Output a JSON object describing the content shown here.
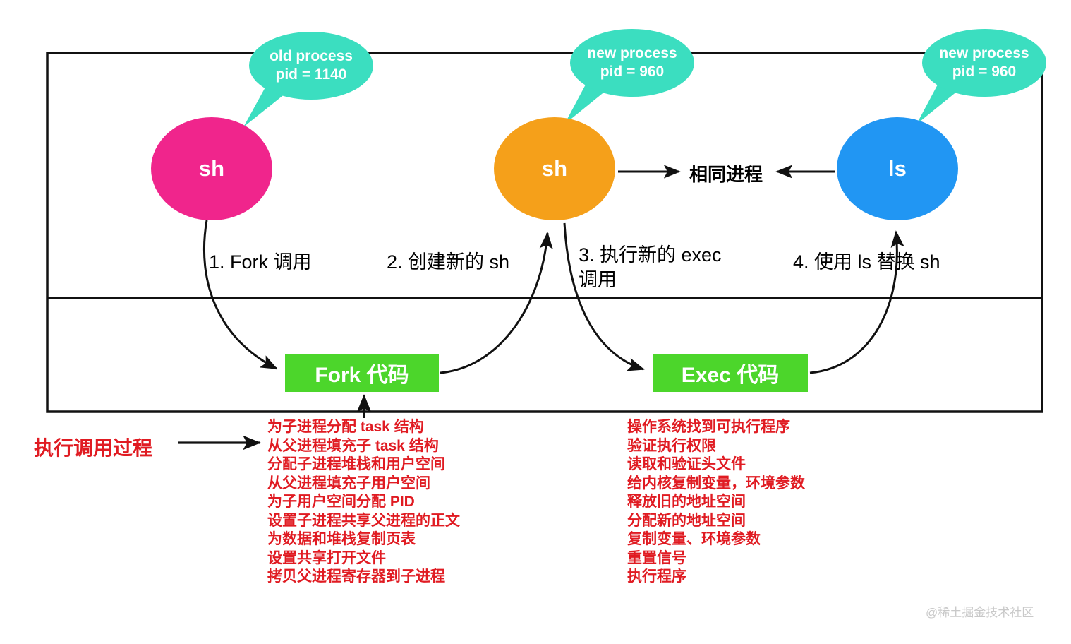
{
  "colors": {
    "pink": "#F0258C",
    "orange": "#F5A01A",
    "blue": "#2196F3",
    "teal": "#3BDEC0",
    "green": "#4CD62B",
    "red": "#E01B22",
    "black": "#111111",
    "watermark_gray": "#c9c9c9"
  },
  "frame": {
    "outer_border": "black",
    "divider": "horizontal-line"
  },
  "bubbles": [
    {
      "name": "old-process-bubble",
      "line1": "old process",
      "line2": "pid = 1140"
    },
    {
      "name": "new-process-bubble-middle",
      "line1": "new process",
      "line2": "pid = 960"
    },
    {
      "name": "new-process-bubble-right",
      "line1": "new process",
      "line2": "pid = 960"
    }
  ],
  "circles": [
    {
      "name": "sh-old",
      "label": "sh",
      "color": "#F0258C"
    },
    {
      "name": "sh-new",
      "label": "sh",
      "color": "#F5A01A"
    },
    {
      "name": "ls",
      "label": "ls",
      "color": "#2196F3"
    }
  ],
  "same_process_label": "相同进程",
  "steps": [
    {
      "id": "step-1",
      "text": "1. Fork 调用"
    },
    {
      "id": "step-2",
      "text": "2. 创建新的 sh"
    },
    {
      "id": "step-3",
      "text": "3. 执行新的 exec\n调用"
    },
    {
      "id": "step-4",
      "text": "4. 使用 ls 替换 sh"
    }
  ],
  "code_boxes": [
    {
      "id": "fork-code-box",
      "label": "Fork 代码"
    },
    {
      "id": "exec-code-box",
      "label": "Exec 代码"
    }
  ],
  "exec_process_label": "执行调用过程",
  "fork_steps": [
    "为子进程分配 task 结构",
    "从父进程填充子 task 结构",
    "分配子进程堆栈和用户空间",
    "从父进程填充子用户空间",
    "为子用户空间分配 PID",
    "设置子进程共享父进程的正文",
    "为数据和堆栈复制页表",
    "设置共享打开文件",
    "拷贝父进程寄存器到子进程"
  ],
  "exec_steps": [
    "操作系统找到可执行程序",
    "验证执行权限",
    "读取和验证头文件",
    "给内核复制变量，环境参数",
    "释放旧的地址空间",
    "分配新的地址空间",
    "复制变量、环境参数",
    "重置信号",
    "执行程序"
  ],
  "watermark": "@稀土掘金技术社区"
}
